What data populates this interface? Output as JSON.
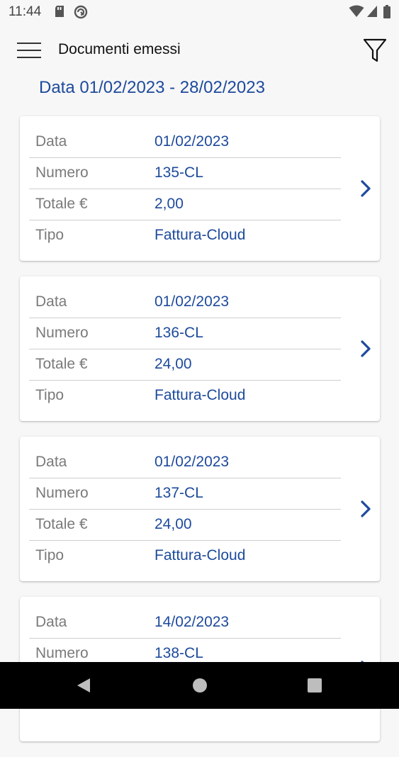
{
  "status_bar": {
    "time": "11:44"
  },
  "app_bar": {
    "title": "Documenti emessi"
  },
  "date_range": "Data 01/02/2023 - 28/02/2023",
  "labels": {
    "data": "Data",
    "numero": "Numero",
    "totale": "Totale €",
    "tipo": "Tipo"
  },
  "documents": [
    {
      "data": "01/02/2023",
      "numero": "135-CL",
      "totale": "2,00",
      "tipo": "Fattura-Cloud"
    },
    {
      "data": "01/02/2023",
      "numero": "136-CL",
      "totale": "24,00",
      "tipo": "Fattura-Cloud"
    },
    {
      "data": "01/02/2023",
      "numero": "137-CL",
      "totale": "24,00",
      "tipo": "Fattura-Cloud"
    },
    {
      "data": "14/02/2023",
      "numero": "138-CL",
      "totale": "",
      "tipo": ""
    }
  ],
  "colors": {
    "accent": "#1d4a9c",
    "label": "#7a7a7a",
    "background": "#f7f7f7"
  },
  "icons": [
    "menu-icon",
    "filter-icon",
    "chevron-right-icon",
    "back-icon",
    "home-icon",
    "recents-icon"
  ]
}
